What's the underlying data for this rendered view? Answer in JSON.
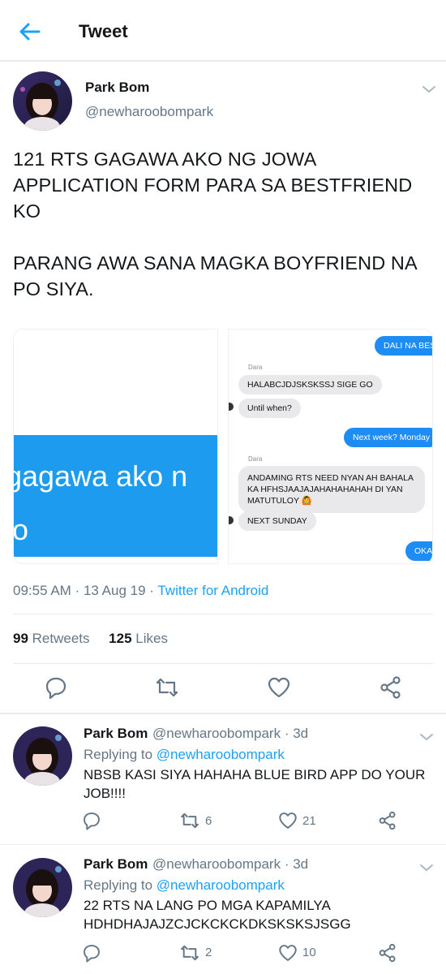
{
  "header": {
    "title": "Tweet"
  },
  "tweet": {
    "name": "Park Bom",
    "handle": "@newharoobompark",
    "text_para1": "121 RTS GAGAWA AKO NG JOWA APPLICATION FORM PARA SA BESTFRIEND KO",
    "text_para2": "PARANG AWA SANA MAGKA BOYFRIEND NA PO SIYA.",
    "media_left_text_line1": "gagawa ako n",
    "media_left_text_line2": "o",
    "time": "09:55 AM",
    "date": "13 Aug 19",
    "client": "Twitter for Android",
    "retweets_count": "99",
    "retweets_label": "Retweets",
    "likes_count": "125",
    "likes_label": "Likes"
  },
  "chat": {
    "msg1": "DALI NA BES",
    "sender1": "Dara",
    "msg2": "HALABCJDJSKSKSSJ SIGE GO",
    "msg3": "Until when?",
    "msg4": "Next week? Monday",
    "sender2": "Dara",
    "msg5": "ANDAMING RTS NEED NYAN AH BAHALA KA HFHSJAAJAJAHAHAHAHAH DI YAN MATUTULOY 🙆",
    "msg6": "NEXT SUNDAY",
    "msg7": "OKAY"
  },
  "replies": [
    {
      "name": "Park Bom",
      "handle": "@newharoobompark",
      "age": "· 3d",
      "replying_label": "Replying to",
      "replying_to": "@newharoobompark",
      "text": "NBSB KASI SIYA HAHAHA BLUE BIRD APP DO YOUR JOB!!!!",
      "retweets": "6",
      "likes": "21"
    },
    {
      "name": "Park Bom",
      "handle": "@newharoobompark",
      "age": "· 3d",
      "replying_label": "Replying to",
      "replying_to": "@newharoobompark",
      "text": "22 RTS NA LANG PO MGA KAPAMILYA HDHDHAJAJZCJCKCKCKDKSKSKSJSGG",
      "retweets": "2",
      "likes": "10"
    }
  ],
  "colors": {
    "accent": "#1da1f2",
    "secondary_text": "#657786",
    "divider": "#e6ecf0",
    "media_blue": "#1c9bef"
  },
  "icons": [
    "back-arrow-icon",
    "chevron-down-icon",
    "reply-icon",
    "retweet-icon",
    "like-icon",
    "share-icon"
  ]
}
